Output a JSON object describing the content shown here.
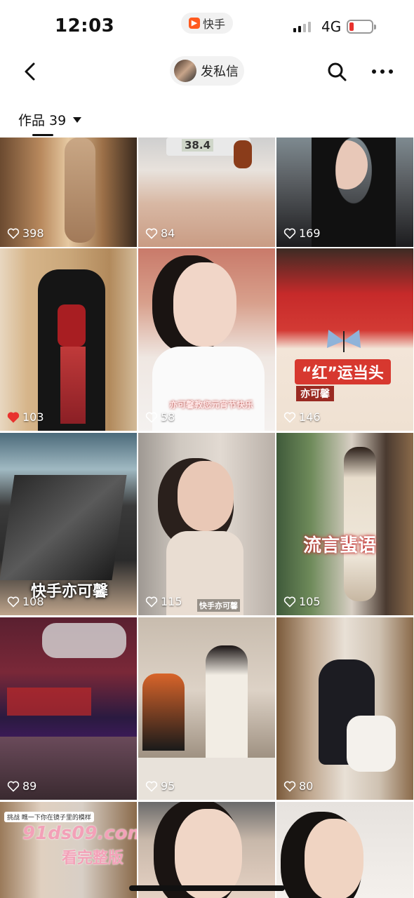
{
  "status_bar": {
    "time": "12:03",
    "app": "快手",
    "network": "4G"
  },
  "nav": {
    "dm_label": "发私信"
  },
  "tab": {
    "label": "作品 39"
  },
  "colors": {
    "like_red": "#e8322e",
    "bg": "#ffffff"
  },
  "icons": [
    "back-icon",
    "search-icon",
    "more-icon",
    "heart-icon",
    "caret-down-icon"
  ],
  "posts": [
    {
      "likes": "398",
      "liked": false
    },
    {
      "likes": "84",
      "liked": false,
      "text": "38.4"
    },
    {
      "likes": "169",
      "liked": false
    },
    {
      "likes": "103",
      "liked": true
    },
    {
      "likes": "58",
      "liked": false,
      "text": "亦可馨教您元宵节快乐"
    },
    {
      "likes": "146",
      "liked": false,
      "text": "“红”运当头",
      "text2": "亦可馨"
    },
    {
      "likes": "108",
      "liked": false,
      "text": "快手亦可馨"
    },
    {
      "likes": "115",
      "liked": false,
      "text": "快手亦可馨"
    },
    {
      "likes": "105",
      "liked": false,
      "text": "流言蜚语"
    },
    {
      "likes": "89",
      "liked": false
    },
    {
      "likes": "95",
      "liked": false
    },
    {
      "likes": "80",
      "liked": false
    },
    {
      "text": "91ds09.com",
      "text2": "看完整版",
      "text3": "挑战 瞧一下你在镜子里的模样"
    },
    {},
    {}
  ]
}
